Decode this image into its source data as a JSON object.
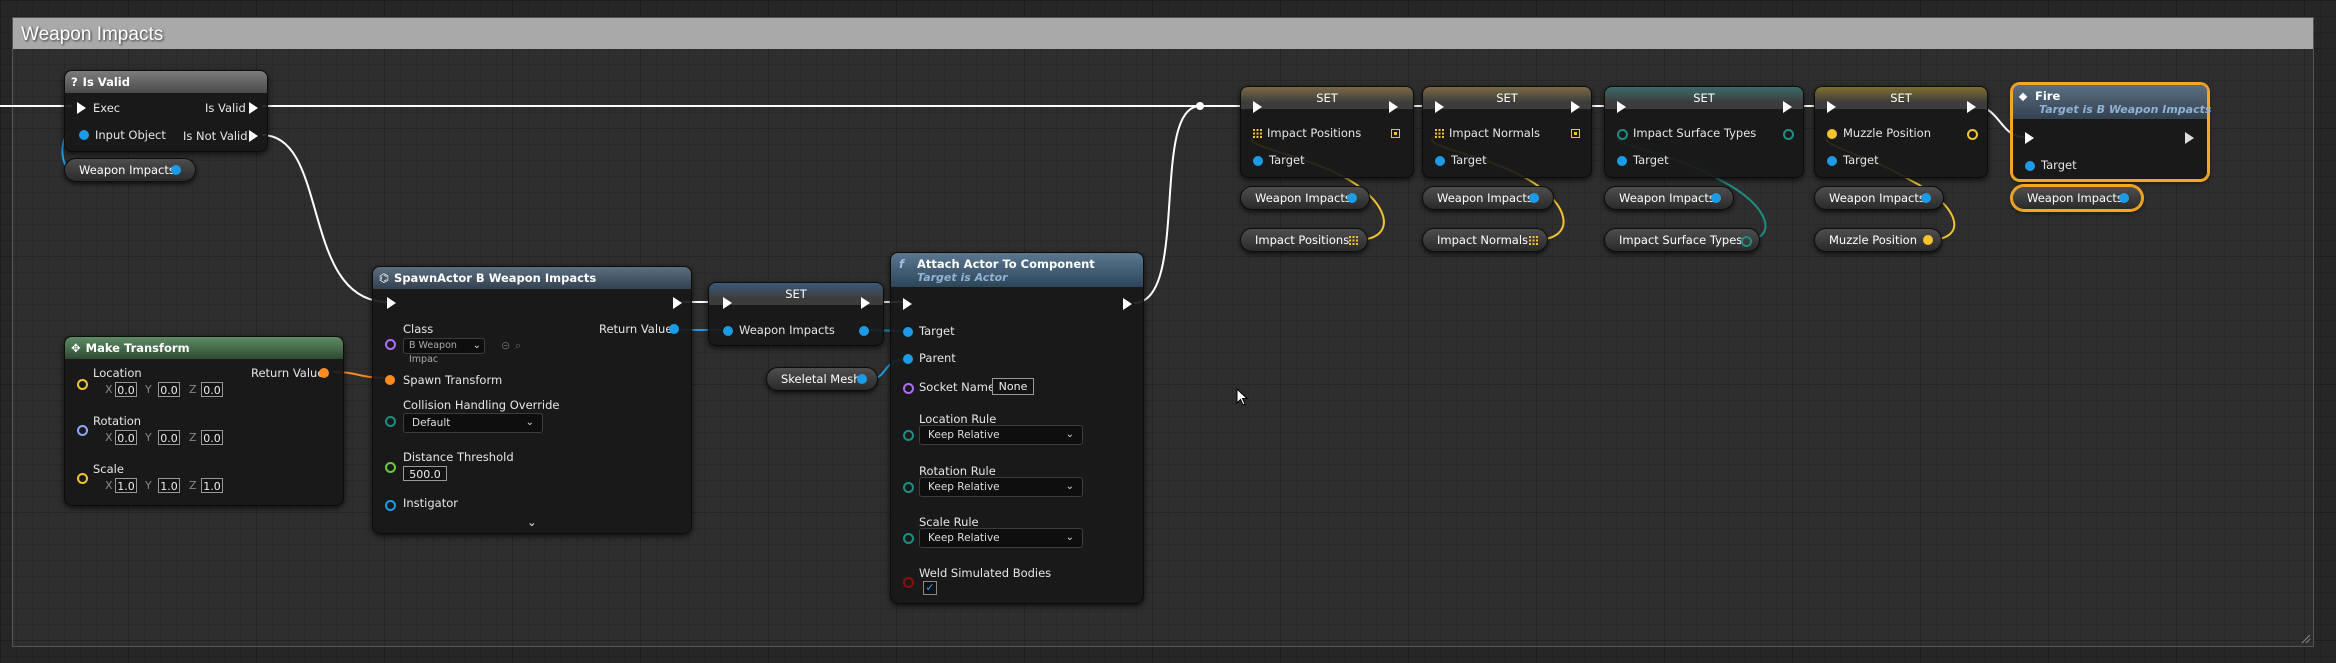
{
  "comment": {
    "title": "Weapon Impacts"
  },
  "is_valid": {
    "title": "Is Valid",
    "exec": "Exec",
    "is_valid": "Is Valid",
    "input_object": "Input Object",
    "is_not_valid": "Is Not Valid"
  },
  "get_weapon_impacts": "Weapon Impacts",
  "make_transform": {
    "title": "Make Transform",
    "return_value": "Return Value",
    "location": {
      "label": "Location",
      "x": "0.0",
      "y": "0.0",
      "z": "0.0"
    },
    "rotation": {
      "label": "Rotation",
      "x": "0.0",
      "y": "0.0",
      "z": "0.0"
    },
    "scale": {
      "label": "Scale",
      "x": "1.0",
      "y": "1.0",
      "z": "1.0"
    },
    "axes": {
      "x": "X",
      "y": "Y",
      "z": "Z"
    }
  },
  "spawn": {
    "title": "SpawnActor B Weapon Impacts",
    "class_label": "Class",
    "class_value": "B Weapon Impac",
    "return_value": "Return Value",
    "spawn_transform": "Spawn Transform",
    "collision_label": "Collision Handling Override",
    "collision_value": "Default",
    "distance_label": "Distance Threshold",
    "distance_value": "500.0",
    "instigator": "Instigator",
    "expand": "⌄"
  },
  "set_main": {
    "title": "SET",
    "var": "Weapon Impacts"
  },
  "skeletal_mesh": "Skeletal Mesh",
  "attach": {
    "title": "Attach Actor To Component",
    "subtitle": "Target is Actor",
    "icon": "f",
    "target": "Target",
    "parent": "Parent",
    "socket_label": "Socket Name",
    "socket_value": "None",
    "location_rule": "Location Rule",
    "rotation_rule": "Rotation Rule",
    "scale_rule": "Scale Rule",
    "rule_value": "Keep Relative",
    "weld": "Weld Simulated Bodies",
    "weld_checked": "✓"
  },
  "set_nodes": [
    {
      "title": "SET",
      "var": "Impact Positions",
      "target": "Target",
      "get_target": "Weapon Impacts",
      "get_value": "Impact Positions"
    },
    {
      "title": "SET",
      "var": "Impact Normals",
      "target": "Target",
      "get_target": "Weapon Impacts",
      "get_value": "Impact Normals"
    },
    {
      "title": "SET",
      "var": "Impact Surface Types",
      "target": "Target",
      "get_target": "Weapon Impacts",
      "get_value": "Impact Surface Types"
    },
    {
      "title": "SET",
      "var": "Muzzle Position",
      "target": "Target",
      "get_target": "Weapon Impacts",
      "get_value": "Muzzle Position"
    }
  ],
  "fire": {
    "title": "Fire",
    "subtitle": "Target is B Weapon Impacts",
    "target": "Target",
    "get_target": "Weapon Impacts"
  },
  "colors": {
    "exec": "#ffffff",
    "object": "#1e9be6",
    "vector": "#f4c430",
    "transform": "#ff8a1f",
    "teal": "#1e8e85"
  }
}
